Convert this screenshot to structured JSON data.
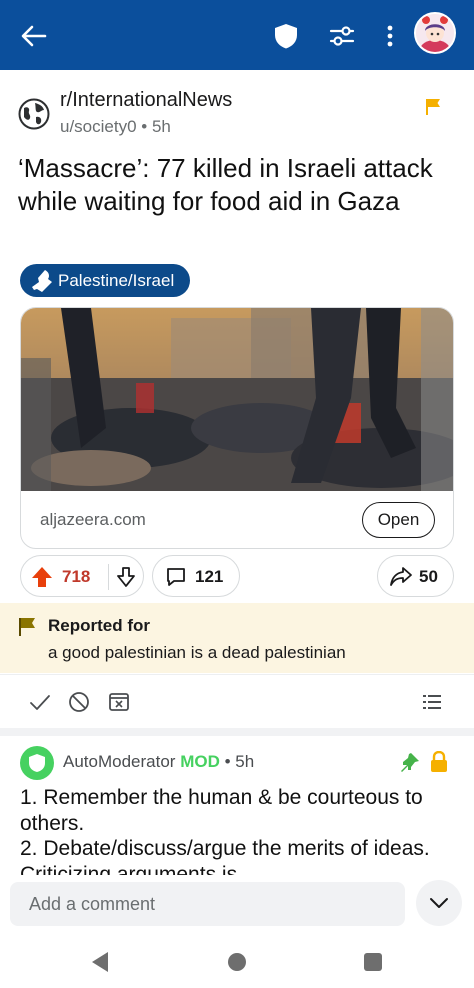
{
  "colors": {
    "topbar": "#0b4f9c",
    "flair_bg": "#0c4a8a",
    "upvote": "#c0392b",
    "mod_green": "#46d160",
    "report_bg": "#fcf5e1",
    "flag_yellow": "#f5b000"
  },
  "topbar": {
    "back_icon": "arrow-left-icon",
    "shield_icon": "shield-icon",
    "filter_icon": "sliders-icon",
    "more_icon": "more-vertical-icon"
  },
  "post": {
    "subreddit": "r/InternationalNews",
    "author": "u/society0",
    "age": "5h",
    "title": "‘Massacre’: 77 killed in Israeli attack while waiting for food aid in Gaza",
    "flair": "Palestine/Israel",
    "link": {
      "domain": "aljazeera.com",
      "open_label": "Open"
    },
    "votes": "718",
    "comments": "121",
    "shares": "50"
  },
  "report": {
    "title": "Reported for",
    "reason": "a good palestinian is a dead palestinian"
  },
  "comment": {
    "author": "AutoModerator",
    "mod_badge": "MOD",
    "age": "5h",
    "body_line1": "1. Remember the human & be courteous to others.",
    "body_line2": "2. Debate/discuss/argue the merits of ideas. Criticizing arguments is"
  },
  "composer": {
    "placeholder": "Add a comment"
  }
}
